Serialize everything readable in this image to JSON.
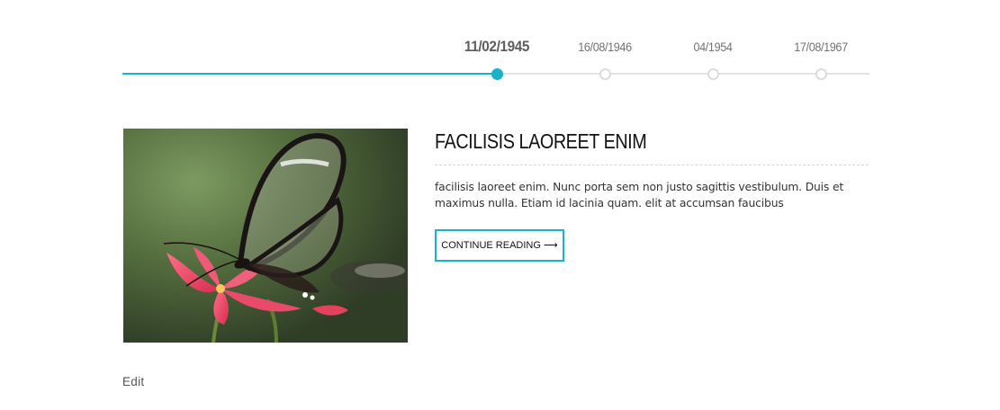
{
  "timeline": {
    "progress": 0.5,
    "events": [
      {
        "date": "11/02/1945",
        "selected": true
      },
      {
        "date": "16/08/1946",
        "selected": false
      },
      {
        "date": "04/1954",
        "selected": false
      },
      {
        "date": "17/08/1967",
        "selected": false
      }
    ]
  },
  "post": {
    "image_subject": "glasswing butterfly on pink flower",
    "title": "FACILISIS LAOREET ENIM",
    "excerpt": "facilisis laoreet enim. Nunc porta sem non justo sagittis vestibulum. Duis et maximus nulla. Etiam id lacinia quam. elit at accumsan faucibus",
    "read_more_label": "CONTINUE READING",
    "read_more_arrow": "⟶"
  },
  "footer": {
    "edit_label": "Edit"
  },
  "colors": {
    "accent": "#1ab2c9",
    "track": "#e4e4e4",
    "text_dark": "#111111"
  }
}
